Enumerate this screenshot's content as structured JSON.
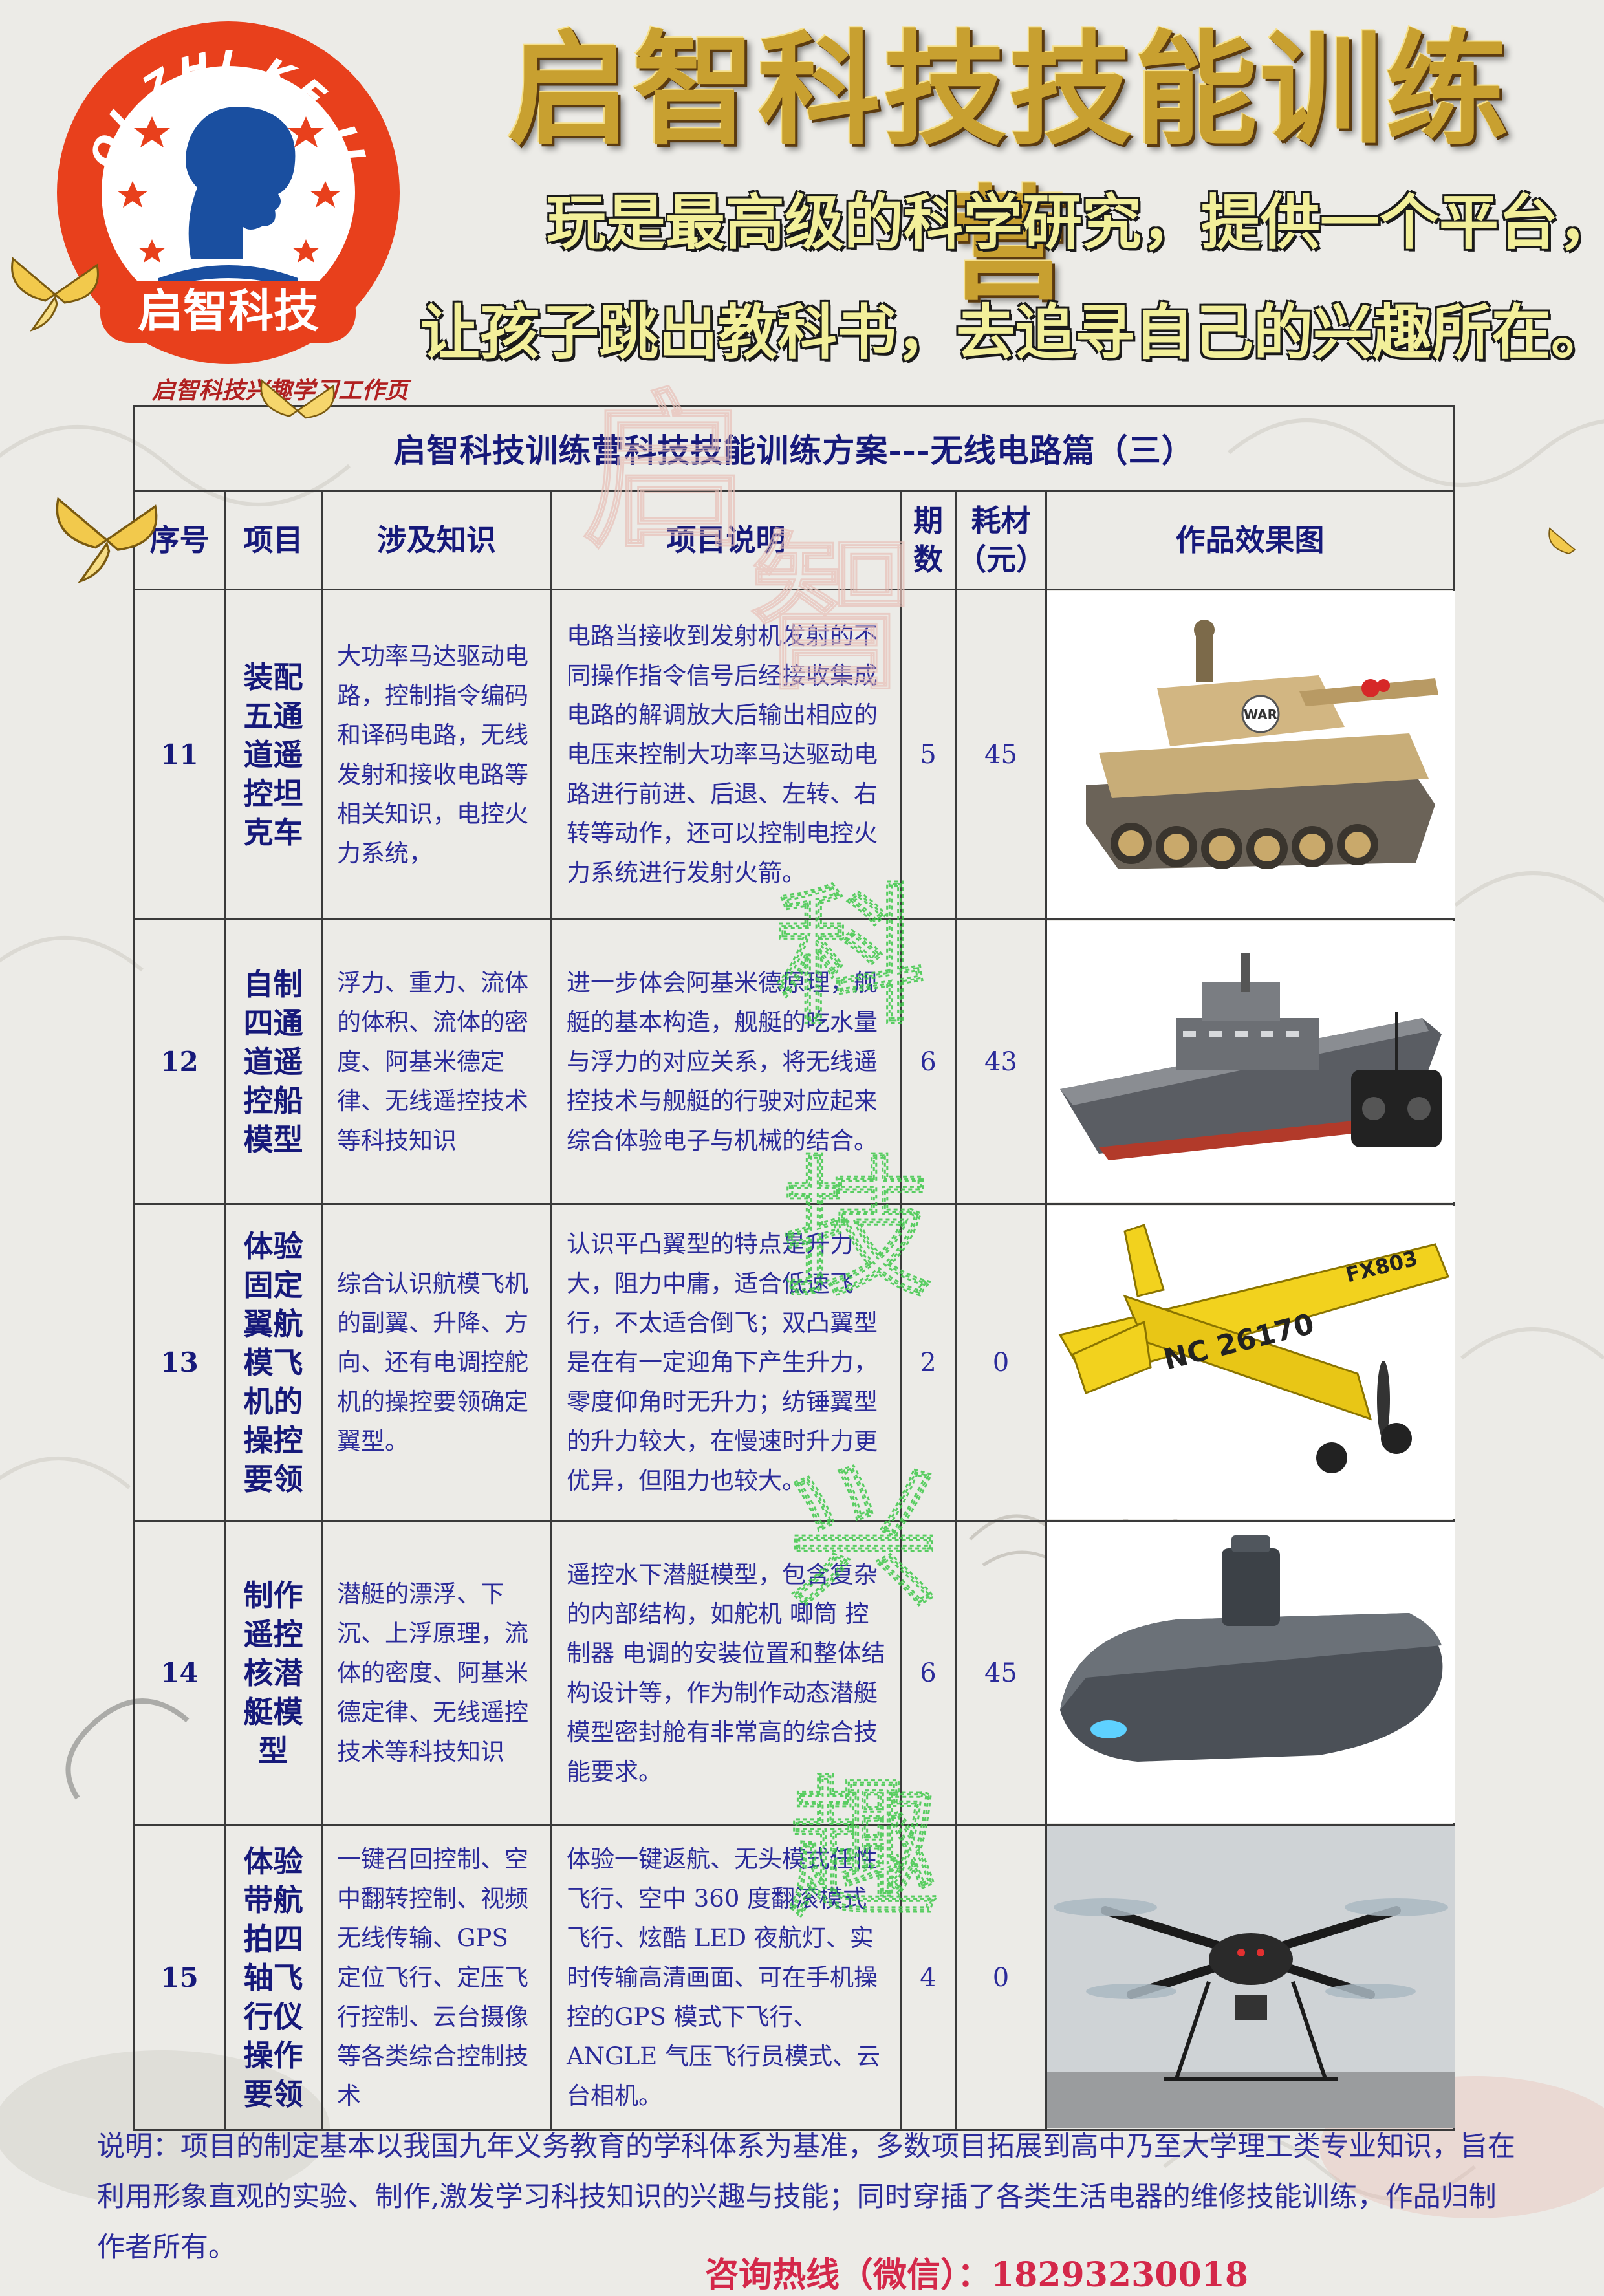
{
  "header": {
    "logo_ring_text": "QI ZHI KE JI",
    "logo_badge": "启智科技",
    "title": "启智科技技能训练营",
    "slogan_line1": "玩是最高级的科学研究，提供一个平台，",
    "slogan_line2": "让孩子跳出教科书，去追寻自己的兴趣所在。",
    "caption": "启智科技兴趣学习工作页"
  },
  "table": {
    "title": "启智科技训练营科技技能训练方案---无线电路篇（三）",
    "headers": {
      "no": "序号",
      "item": "项目",
      "knowledge": "涉及知识",
      "description": "项目说明",
      "periods": "期数",
      "cost": "耗材（元）",
      "image": "作品效果图"
    },
    "rows": [
      {
        "no": "11",
        "item": "装配五通道遥控坦克车",
        "knowledge": "大功率马达驱动电路，控制指令编码和译码电路，无线发射和接收电路等相关知识，电控火力系统，",
        "description": "电路当接收到发射机发射的不同操作指令信号后经接收集成电路的解调放大后输出相应的电压来控制大功率马达驱动电路进行前进、后退、左转、右转等动作，还可以控制电控火力系统进行发射火箭。",
        "periods": "5",
        "cost": "45",
        "image_icon": "tank-icon"
      },
      {
        "no": "12",
        "item": "自制四通道遥控船模型",
        "knowledge": "浮力、重力、流体的体积、流体的密度、阿基米德定律、无线遥控技术等科技知识",
        "description": "进一步体会阿基米德原理，舰艇的基本构造，舰艇的吃水量与浮力的对应关系，将无线遥控技术与舰艇的行驶对应起来综合体验电子与机械的结合。",
        "periods": "6",
        "cost": "43",
        "image_icon": "ship-icon"
      },
      {
        "no": "13",
        "item": "体验固定翼航模飞机的操控要领",
        "knowledge": "综合认识航模飞机的副翼、升降、方向、还有电调控舵机的操控要领确定翼型。",
        "description": "认识平凸翼型的特点是升力大，阻力中庸，适合低速飞行，不太适合倒飞；双凸翼型是在有一定迎角下产生升力，零度仰角时无升力；纺锤翼型的升力较大，在慢速时升力更优异，但阻力也较大。",
        "periods": "2",
        "cost": "0",
        "image_icon": "airplane-icon",
        "plane_reg": "NC 26170",
        "plane_code": "FX803"
      },
      {
        "no": "14",
        "item": "制作遥控核潜艇模型",
        "knowledge": "潜艇的漂浮、下沉、上浮原理，流体的密度、阿基米德定律、无线遥控技术等科技知识",
        "description": "遥控水下潜艇模型，包含复杂的内部结构，如舵机 唧筒 控制器 电调的安装位置和整体结构设计等，作为制作动态潜艇模型密封舱有非常高的综合技能要求。",
        "periods": "6",
        "cost": "45",
        "image_icon": "submarine-icon"
      },
      {
        "no": "15",
        "item": "体验带航拍四轴飞行仪操作要领",
        "knowledge": "一键召回控制、空中翻转控制、视频无线传输、GPS 定位飞行、定压飞行控制、云台摄像等各类综合控制技术",
        "description": "体验一键返航、无头模式任性飞行、空中 360 度翻滚模式飞行、炫酷 LED 夜航灯、实时传输高清画面、可在手机操控的GPS 模式下飞行、ANGLE 气压飞行员模式、云台相机。",
        "periods": "4",
        "cost": "0",
        "image_icon": "quadcopter-icon"
      }
    ]
  },
  "footer": {
    "note": "说明：项目的制定基本以我国九年义务教育的学科体系为基准，多数项目拓展到高中乃至大学理工类专业知识，旨在利用形象直观的实验、制作,激发学习科技知识的兴趣与技能；同时穿插了各类生活电器的维修技能训练，作品归制作者所有。",
    "hotline": "咨询热线（微信）：18293230018"
  },
  "watermark": {
    "big_chars": [
      "启",
      "智"
    ],
    "vertical_chars": [
      "科",
      "技",
      "兴",
      "趣"
    ]
  },
  "colors": {
    "title_gold": "#c8a030",
    "slogan_yellow": "#f2ef9a",
    "table_text": "#2b2b9a",
    "hotline": "#d4284a",
    "logo_ring": "#e8401c",
    "watermark_green": "#3fc84a"
  }
}
